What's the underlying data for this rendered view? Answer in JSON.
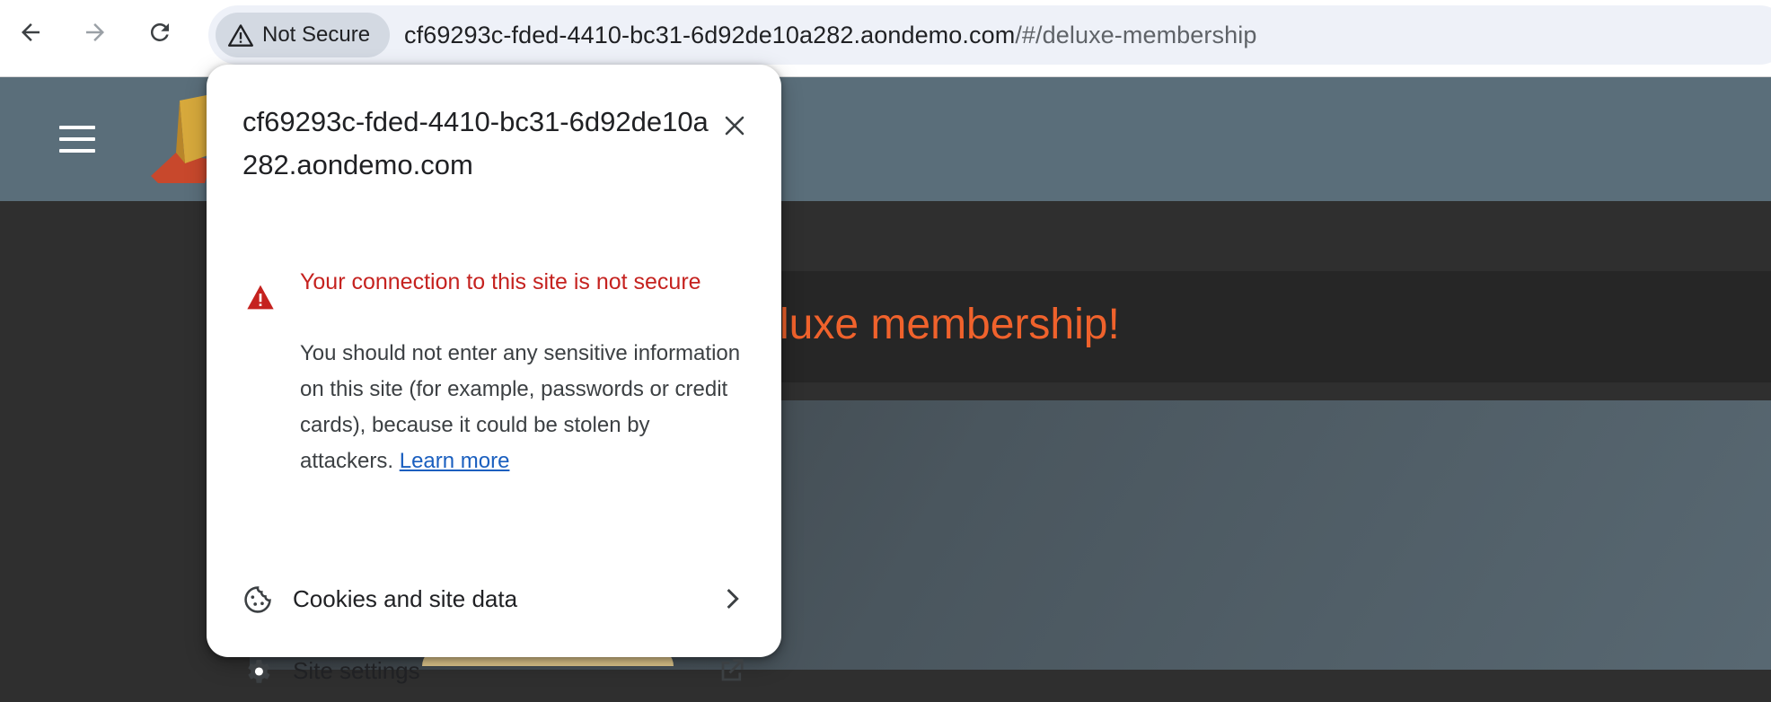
{
  "browser": {
    "security_chip_label": "Not Secure",
    "url_host": "cf69293c-fded-4410-bc31-6d92de10a282.aondemo.com",
    "url_path": "/#/deluxe-membership"
  },
  "page": {
    "banner_title": "luxe membership!"
  },
  "popup": {
    "host": "cf69293c-fded-4410-bc31-6d92de10a282.aondemo.com",
    "warning_title": "Your connection to this site is not secure",
    "warning_body": "You should not enter any sensitive information on this site (for example, passwords or credit cards), because it could be stolen by attackers.",
    "learn_more": "Learn more",
    "cookies_label": "Cookies and site data",
    "site_settings_label": "Site settings"
  },
  "colors": {
    "warning_red": "#c5221f",
    "link_blue": "#1a5fbf",
    "header_bg": "#5a6e7a",
    "accent_orange": "#f0622c"
  },
  "icons": [
    "back-arrow-icon",
    "forward-arrow-icon",
    "reload-icon",
    "warning-triangle-icon",
    "close-icon",
    "cookie-icon",
    "chevron-right-icon",
    "gear-icon",
    "open-in-new-icon",
    "hamburger-menu-icon"
  ]
}
